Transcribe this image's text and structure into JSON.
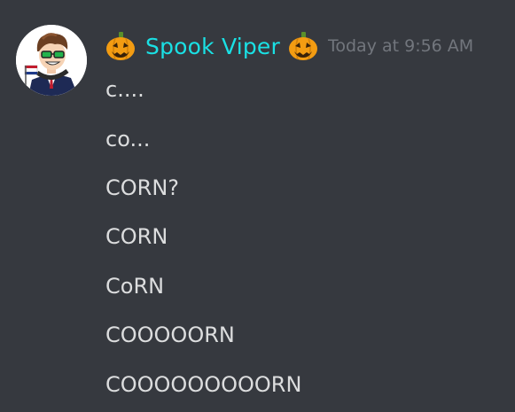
{
  "author": {
    "username": "Spook Viper",
    "name_decoration": "jack-o-lantern-icon",
    "username_color": "#1ae0e4",
    "timestamp": "Today at 9:56 AM"
  },
  "messages": [
    {
      "text": "c...."
    },
    {
      "text": "co..."
    },
    {
      "text": "CORN?"
    },
    {
      "text": "CORN"
    },
    {
      "text": "CoRN"
    },
    {
      "text": "COOOOORN"
    },
    {
      "text": "COOOOOOOOORN"
    }
  ],
  "colors": {
    "background": "#36393f",
    "message_text": "#dcddde",
    "timestamp": "#72767d"
  }
}
